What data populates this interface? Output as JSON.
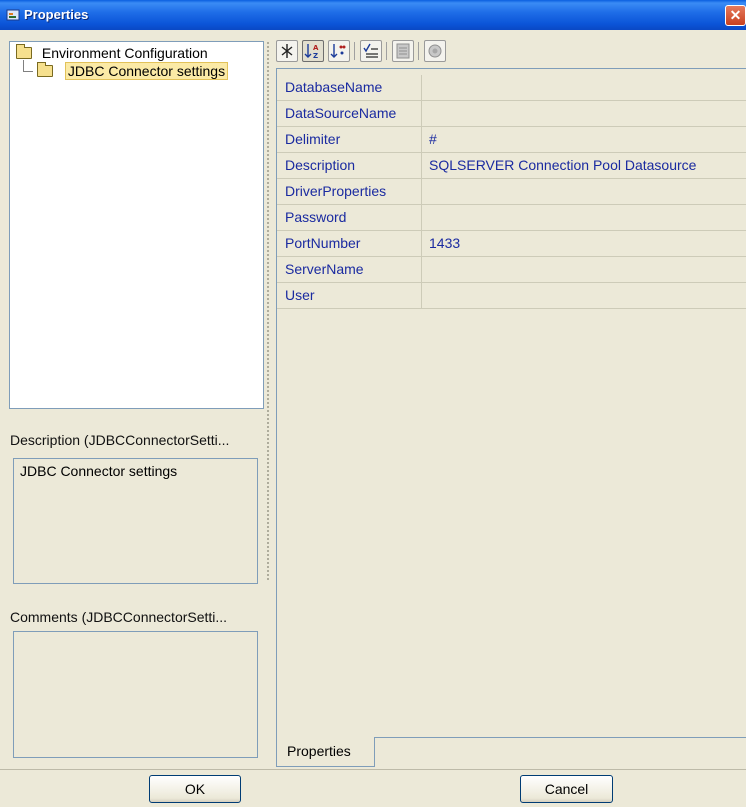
{
  "window": {
    "title": "Properties",
    "close_glyph": "✕"
  },
  "tree": {
    "root_label": "Environment Configuration",
    "child_label": "JDBC Connector settings"
  },
  "description": {
    "label": "Description (JDBCConnectorSetti...",
    "text": "JDBC Connector settings"
  },
  "comments": {
    "label": "Comments (JDBCConnectorSetti...",
    "text": ""
  },
  "toolbar": {
    "icons": [
      "categorize-icon",
      "sort-alpha-icon",
      "sort-reverse-icon",
      "checklist-icon",
      "pages-icon",
      "help-icon"
    ]
  },
  "properties": [
    {
      "name": "DatabaseName",
      "value": ""
    },
    {
      "name": "DataSourceName",
      "value": ""
    },
    {
      "name": "Delimiter",
      "value": "#"
    },
    {
      "name": "Description",
      "value": "SQLSERVER Connection Pool Datasource"
    },
    {
      "name": "DriverProperties",
      "value": ""
    },
    {
      "name": "Password",
      "value": ""
    },
    {
      "name": "PortNumber",
      "value": "1433"
    },
    {
      "name": "ServerName",
      "value": ""
    },
    {
      "name": "User",
      "value": ""
    }
  ],
  "tab_label": "Properties",
  "buttons": {
    "ok": "OK",
    "cancel": "Cancel"
  },
  "colors": {
    "title_bar": "#0b54d8",
    "property_text": "#1a2aa0",
    "selection": "#fbeaa6"
  }
}
